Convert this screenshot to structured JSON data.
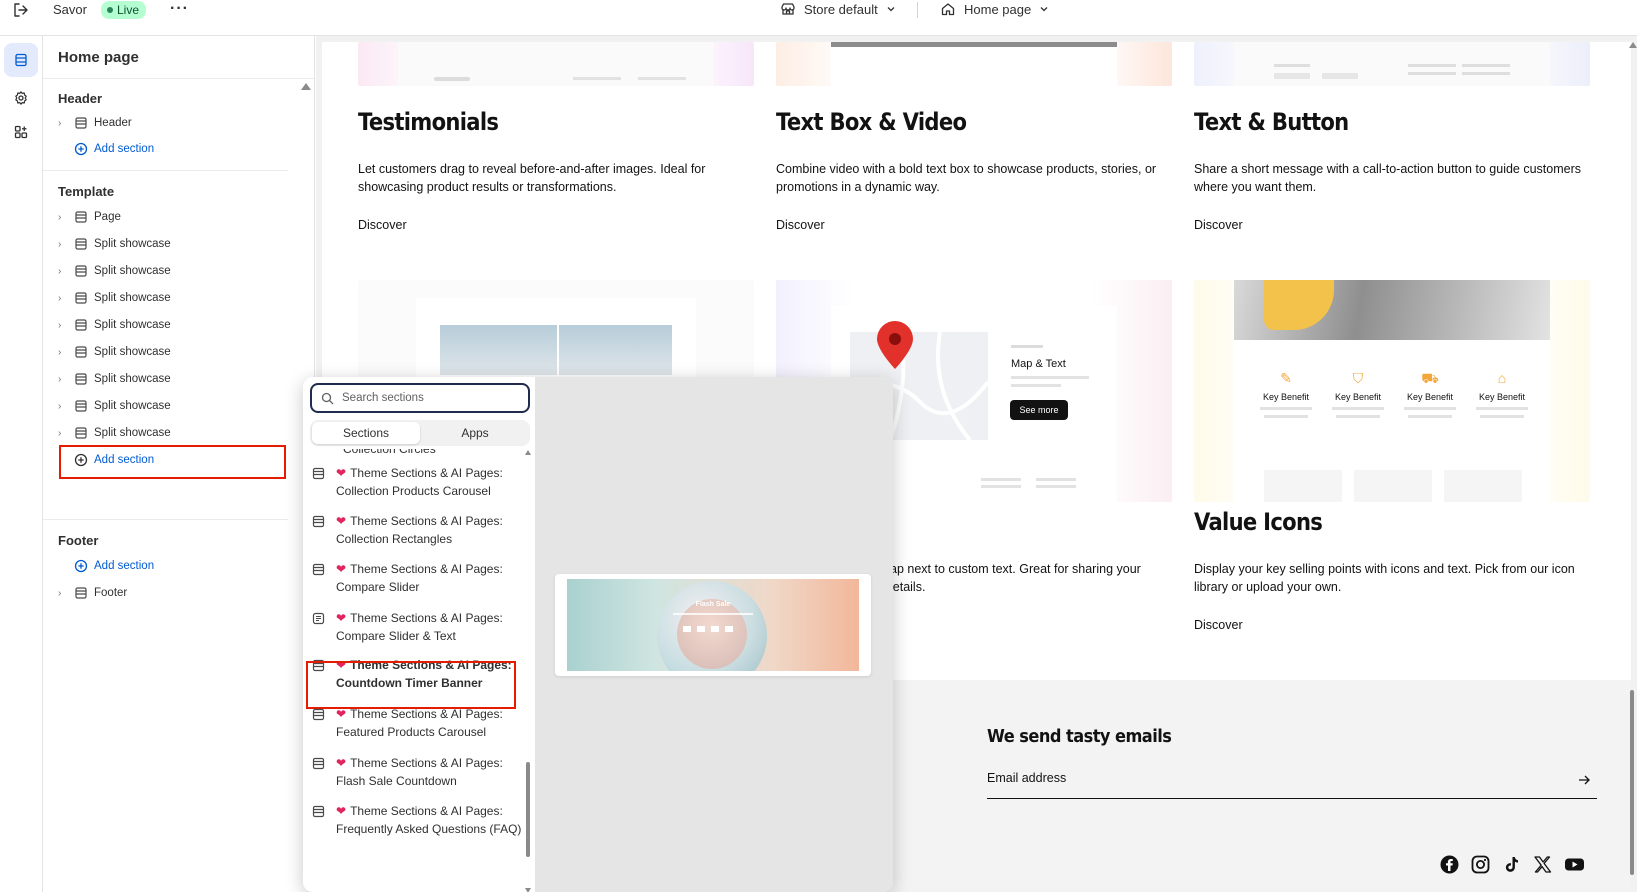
{
  "topbar": {
    "theme_name": "Savor",
    "status": "Live",
    "more": "···",
    "store": "Store default",
    "page": "Home page"
  },
  "sidebar": {
    "title": "Home page",
    "header_group": "Header",
    "header_item": "Header",
    "add_section": "Add section",
    "template_group": "Template",
    "template_items": [
      "Page",
      "Split showcase",
      "Split showcase",
      "Split showcase",
      "Split showcase",
      "Split showcase",
      "Split showcase",
      "Split showcase",
      "Split showcase"
    ],
    "footer_group": "Footer",
    "footer_item": "Footer"
  },
  "preview": {
    "cards_row1": [
      {
        "title": "Testimonials",
        "desc": "Let customers drag to reveal before-and-after images. Ideal for showcasing product results or transformations.",
        "link": "Discover"
      },
      {
        "title": "Text Box & Video",
        "desc": "Combine video with a bold text box to showcase products, stories, or promotions in a dynamic way.",
        "link": "Discover"
      },
      {
        "title": "Text & Button",
        "desc": "Share a short message with a call-to-action button to guide customers where you want them.",
        "link": "Discover"
      }
    ],
    "map_card": {
      "label": "Map & Text",
      "button": "See more",
      "desc_fragment_1": "ap next to custom text. Great for sharing your",
      "desc_fragment_2": "letails."
    },
    "value_card": {
      "benefit": "Key Benefit",
      "title": "Value Icons",
      "desc": "Display your key selling points with icons and text. Pick from our icon library or upload your own.",
      "link": "Discover"
    },
    "newsletter": {
      "title": "We send tasty emails",
      "placeholder": "Email address"
    }
  },
  "picker": {
    "search_placeholder": "Search sections",
    "tab_sections": "Sections",
    "tab_apps": "Apps",
    "cut_item": "Collection Circles",
    "prefix": "Theme Sections & AI Pages:",
    "items": [
      "Collection Products Carousel",
      "Collection Rectangles",
      "Compare Slider",
      "Compare Slider & Text",
      "Countdown Timer Banner",
      "Featured Products Carousel",
      "Flash Sale Countdown",
      "Frequently Asked Questions (FAQ)"
    ],
    "preview_label": "Flash Sale"
  },
  "colors": {
    "accent": "#005bd3",
    "highlight": "#e51c00",
    "live": "#b4fed2",
    "heart": "#e0245e"
  }
}
